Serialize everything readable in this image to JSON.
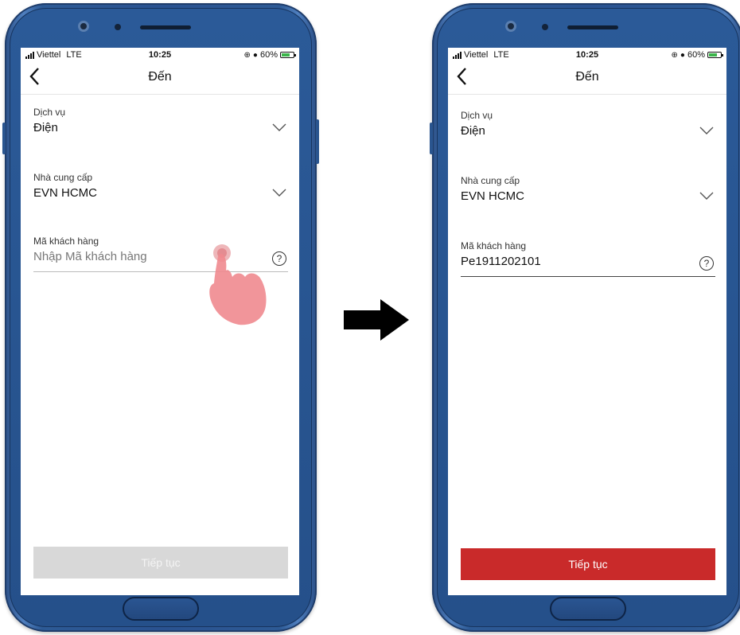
{
  "status_bar": {
    "carrier": "Viettel",
    "network": "LTE",
    "time": "10:25",
    "battery": "60%"
  },
  "screens": [
    {
      "title": "Đến",
      "service_label": "Dịch vụ",
      "service_value": "Điện",
      "provider_label": "Nhà cung cấp",
      "provider_value": "EVN HCMC",
      "customer_label": "Mã khách hàng",
      "customer_placeholder": "Nhập Mã khách hàng",
      "customer_value": "",
      "help_symbol": "?",
      "continue_label": "Tiếp tục",
      "continue_state": "disabled"
    },
    {
      "title": "Đến",
      "service_label": "Dịch vụ",
      "service_value": "Điện",
      "provider_label": "Nhà cung cấp",
      "provider_value": "EVN HCMC",
      "customer_label": "Mã khách hàng",
      "customer_value": "Pe1911202101",
      "help_symbol": "?",
      "continue_label": "Tiếp tục",
      "continue_state": "enabled"
    }
  ],
  "colors": {
    "accent": "#c92a2a",
    "button_disabled": "#d8d8d8",
    "phone_body": "#2a5290"
  },
  "icons": [
    "back-chevron-icon",
    "chevron-down-icon",
    "help-icon",
    "tap-hand-icon",
    "right-arrow-icon"
  ]
}
